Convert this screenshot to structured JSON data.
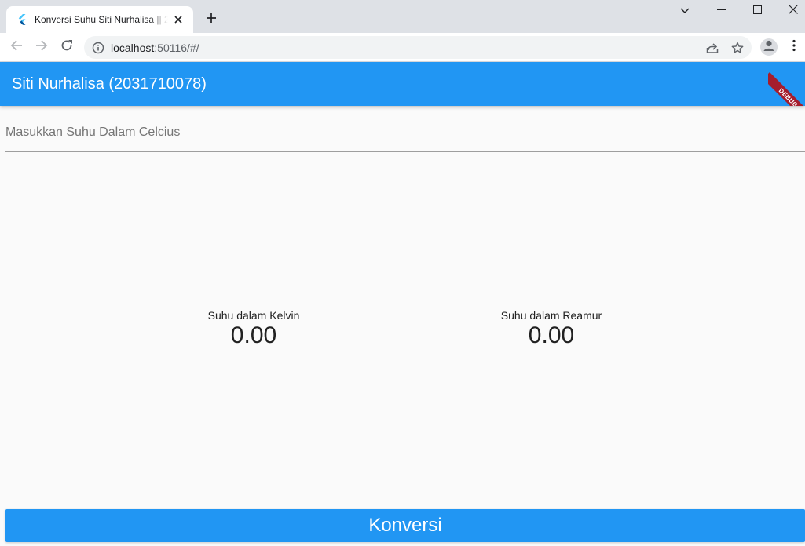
{
  "browser": {
    "tab_title": "Konversi Suhu Siti Nurhalisa || 2031710078",
    "url": {
      "host": "localhost",
      "rest": ":50116/#/"
    }
  },
  "app": {
    "title": "Siti Nurhalisa (2031710078)",
    "debug_banner": "DEBUG",
    "input": {
      "placeholder": "Masukkan Suhu Dalam Celcius",
      "value": ""
    },
    "results": {
      "kelvin": {
        "label": "Suhu dalam Kelvin",
        "value": "0.00"
      },
      "reamur": {
        "label": "Suhu dalam Reamur",
        "value": "0.00"
      }
    },
    "convert_button_label": "Konversi"
  },
  "colors": {
    "primary": "#2196f3",
    "debug_ribbon": "#a51d2d",
    "background": "#fafafa"
  },
  "icons": {
    "tab_favicon": "flutter-logo-icon",
    "tab_close": "close-icon",
    "new_tab": "plus-icon",
    "back": "arrow-left-icon",
    "forward": "arrow-right-icon",
    "reload": "reload-icon",
    "site_info": "info-circle-icon",
    "share": "share-icon",
    "bookmark": "star-icon",
    "profile": "person-icon",
    "menu": "kebab-menu-icon",
    "tab_search": "chevron-down-icon",
    "minimize": "minimize-icon",
    "maximize": "maximize-icon",
    "window_close": "close-icon"
  }
}
